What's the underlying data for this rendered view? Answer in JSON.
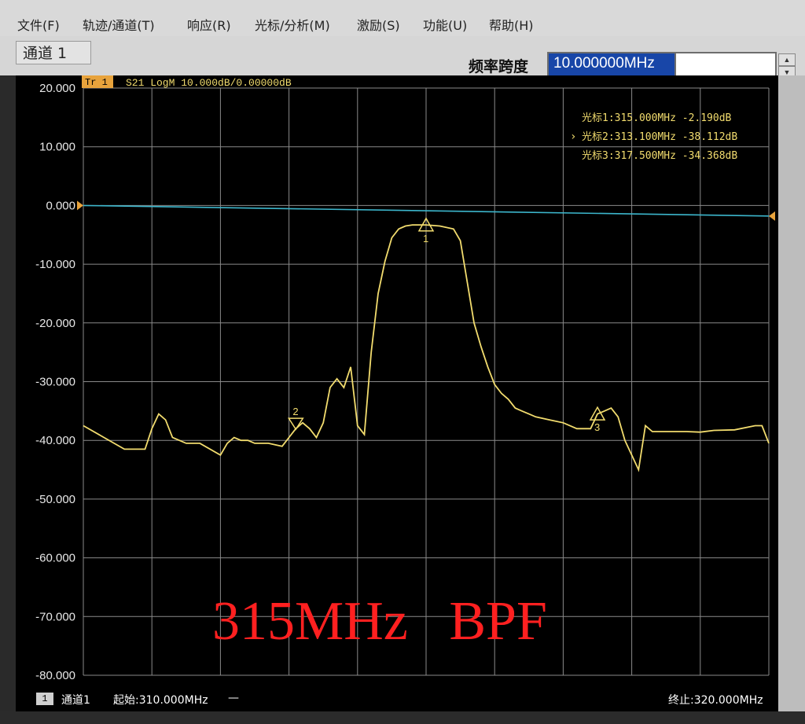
{
  "menu": [
    {
      "label": "文件(F)"
    },
    {
      "label": "轨迹/通道(T)"
    },
    {
      "label": "响应(R)"
    },
    {
      "label": "光标/分析(M)"
    },
    {
      "label": "激励(S)"
    },
    {
      "label": "功能(U)"
    },
    {
      "label": "帮助(H)"
    }
  ],
  "toolbar": {
    "channel_tab": "通道 1",
    "span_label": "频率跨度",
    "span_value": "10.000000MHz"
  },
  "trace_header": {
    "tag": "Tr 1",
    "info": "S21 LogM 10.000dB/0.00000dB"
  },
  "y_axis": {
    "ticks": [
      "20.000",
      "10.000",
      "0.000",
      "-10.000",
      "-20.000",
      "-30.000",
      "-40.000",
      "-50.000",
      "-60.000",
      "-70.000",
      "-80.000"
    ],
    "values": [
      20,
      10,
      0,
      -10,
      -20,
      -30,
      -40,
      -50,
      -60,
      -70,
      -80
    ],
    "unit": "dB",
    "reference_value": 0
  },
  "markers": {
    "readout": [
      {
        "label": "光标1:315.000MHz -2.190dB",
        "active": false
      },
      {
        "label": "光标2:313.100MHz -38.112dB",
        "active": true
      },
      {
        "label": "光标3:317.500MHz -34.368dB",
        "active": false
      }
    ],
    "points": [
      {
        "id": "1",
        "freq": 315.0,
        "db": -2.19
      },
      {
        "id": "2",
        "freq": 313.1,
        "db": -38.112
      },
      {
        "id": "3",
        "freq": 317.5,
        "db": -34.368
      }
    ]
  },
  "overlay_text": "315MHz   BPF",
  "status": {
    "channel_box": "1",
    "channel": "通道1",
    "start": "起始:310.000MHz",
    "stop": "终止:320.000MHz"
  },
  "chart_data": {
    "type": "line",
    "x_range": [
      310,
      320
    ],
    "ylim": [
      -80,
      20
    ],
    "grid": true,
    "series": [
      {
        "color": "#f2dc6e",
        "x": [
          310.0,
          310.3,
          310.6,
          310.9,
          311.0,
          311.1,
          311.2,
          311.3,
          311.5,
          311.7,
          312.0,
          312.1,
          312.2,
          312.3,
          312.4,
          312.5,
          312.7,
          312.9,
          313.0,
          313.1,
          313.2,
          313.3,
          313.4,
          313.5,
          313.6,
          313.7,
          313.8,
          313.9,
          314.0,
          314.1,
          314.2,
          314.3,
          314.4,
          314.5,
          314.6,
          314.7,
          314.8,
          315.0,
          315.2,
          315.4,
          315.5,
          315.6,
          315.7,
          315.8,
          315.9,
          316.0,
          316.1,
          316.2,
          316.3,
          316.4,
          316.5,
          316.6,
          316.8,
          317.0,
          317.2,
          317.4,
          317.5,
          317.6,
          317.7,
          317.8,
          317.9,
          318.0,
          318.1,
          318.2,
          318.3,
          318.5,
          318.8,
          319.0,
          319.2,
          319.5,
          319.8,
          319.9,
          320.0
        ],
        "y": [
          -37.5,
          -39.5,
          -41.5,
          -41.5,
          -38,
          -35.5,
          -36.5,
          -39.5,
          -40.5,
          -40.5,
          -42.5,
          -40.5,
          -39.5,
          -40,
          -40,
          -40.5,
          -40.5,
          -41,
          -39.5,
          -38,
          -37,
          -38,
          -39.5,
          -37,
          -31,
          -29.5,
          -31,
          -27.5,
          -37.5,
          -39,
          -25,
          -15,
          -9.5,
          -5.5,
          -4,
          -3.5,
          -3.3,
          -3.3,
          -3.5,
          -4,
          -6,
          -13,
          -20,
          -24,
          -27.5,
          -30.5,
          -32,
          -33,
          -34.5,
          -35,
          -35.5,
          -36,
          -36.5,
          -37,
          -38,
          -38,
          -35.5,
          -35,
          -34.5,
          -36,
          -40,
          -42.5,
          -45,
          -37.5,
          -38.5,
          -38.5,
          -38.5,
          -38.6,
          -38.3,
          -38.2,
          -37.5,
          -37.5,
          -40.5
        ]
      },
      {
        "color": "#3cb6cc",
        "x": [
          310,
          320
        ],
        "y": [
          0,
          -1.8
        ]
      }
    ]
  }
}
